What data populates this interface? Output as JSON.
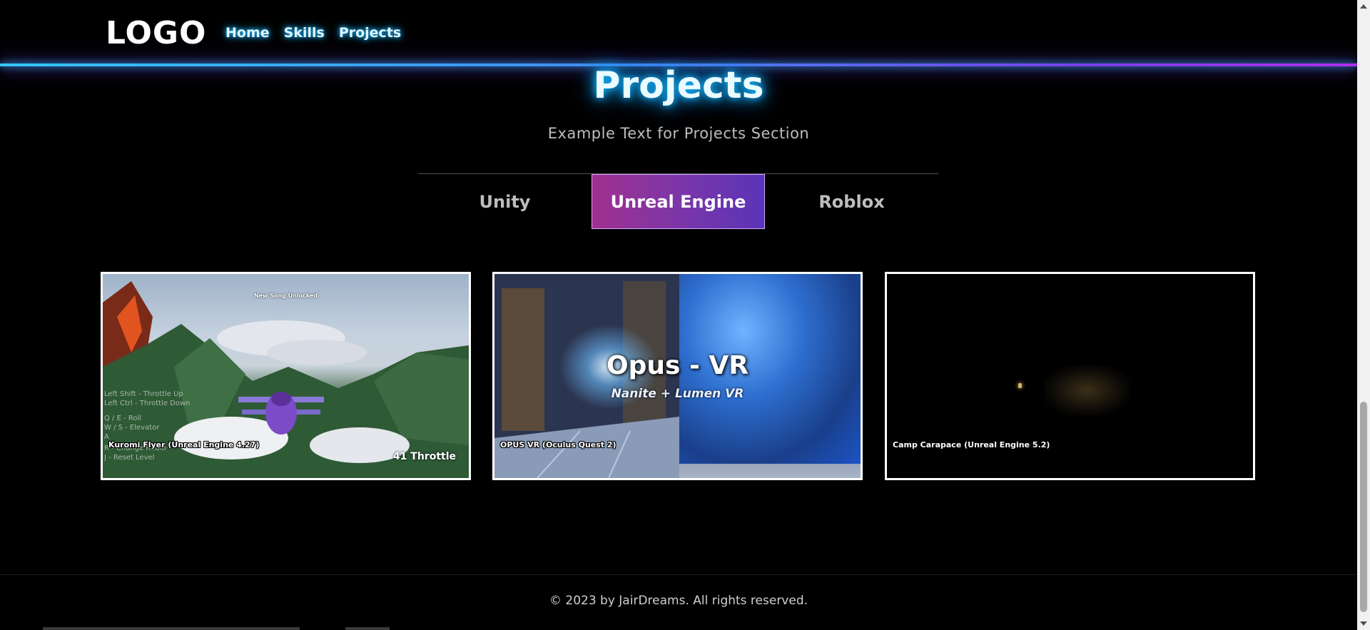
{
  "header": {
    "logo": "LOGO",
    "nav": [
      "Home",
      "Skills",
      "Projects"
    ]
  },
  "section": {
    "title": "Projects",
    "subtitle": "Example Text for Projects Section",
    "tabs": [
      "Unity",
      "Unreal Engine",
      "Roblox"
    ],
    "active_tab": "Unreal Engine"
  },
  "cards": [
    {
      "caption": "Kuromi Flyer (Unreal Engine 4.27)",
      "hud_top": "New Song Unlocked",
      "hud_lines": [
        "Left Shift - Throttle Up",
        "Left Ctrl - Throttle Down",
        "",
        "Q / E - Roll",
        "W / S - Elevator",
        "A",
        "",
        "R - Change Radio",
        "J - Reset Level"
      ],
      "throttle": "41 Throttle"
    },
    {
      "caption": "OPUS VR (Oculus Quest 2)",
      "title": "Opus - VR",
      "subtitle": "Nanite + Lumen VR"
    },
    {
      "caption": "Camp Carapace (Unreal Engine 5.2)"
    }
  ],
  "footer": {
    "copyright": "© 2023 by JairDreams. All rights reserved."
  },
  "colors": {
    "accent_blue": "#17b3ff",
    "accent_purple": "#b02ff0",
    "active_tab_start": "#a0308f",
    "active_tab_end": "#5a34b8"
  }
}
